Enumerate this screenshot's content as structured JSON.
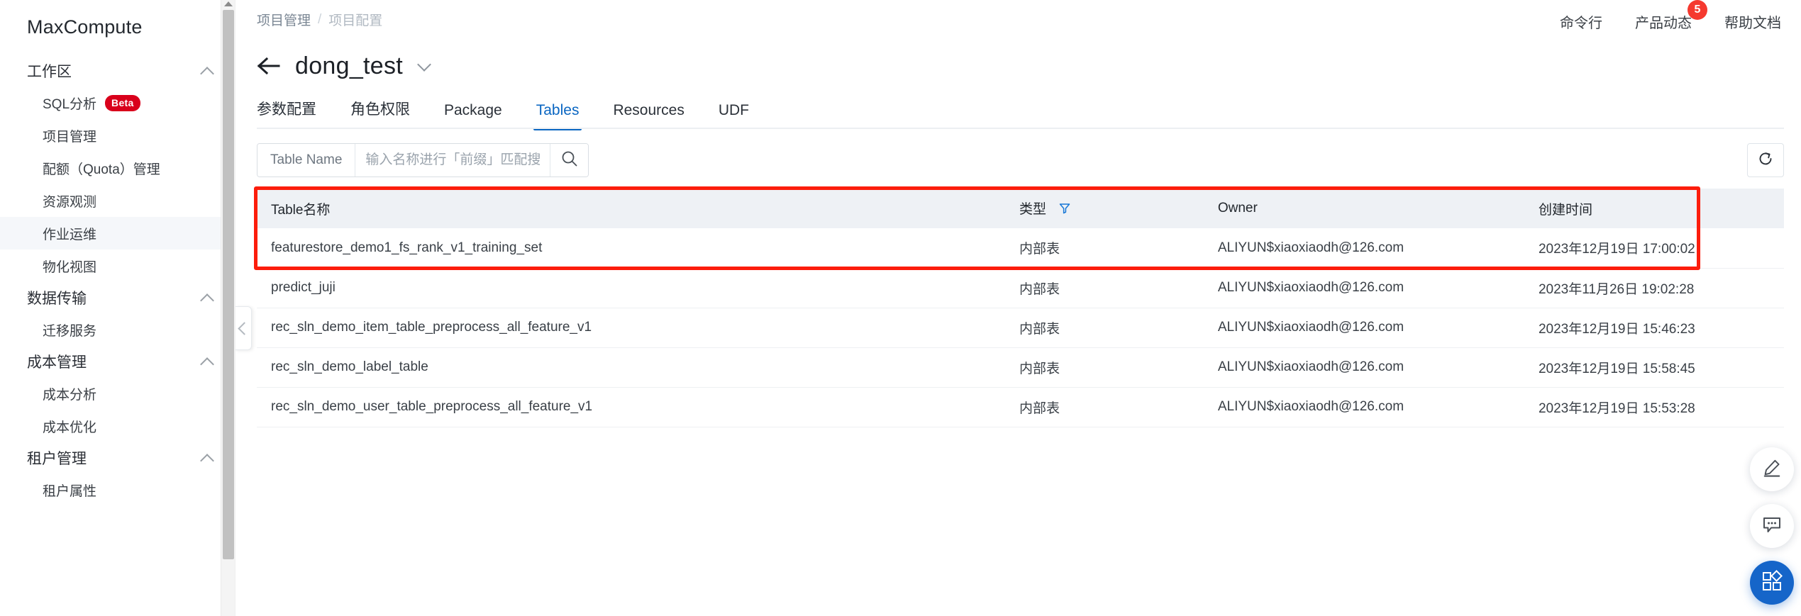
{
  "brand": "MaxCompute",
  "sidebar": {
    "groups": [
      {
        "label": "工作区",
        "items": [
          {
            "label": "SQL分析",
            "badge": "Beta",
            "active": false
          },
          {
            "label": "项目管理",
            "active": false
          },
          {
            "label": "配额（Quota）管理",
            "active": false
          },
          {
            "label": "资源观测",
            "active": false
          },
          {
            "label": "作业运维",
            "active": true
          },
          {
            "label": "物化视图",
            "active": false
          }
        ]
      },
      {
        "label": "数据传输",
        "items": [
          {
            "label": "迁移服务",
            "active": false
          }
        ]
      },
      {
        "label": "成本管理",
        "items": [
          {
            "label": "成本分析",
            "active": false
          },
          {
            "label": "成本优化",
            "active": false
          }
        ]
      },
      {
        "label": "租户管理",
        "items": [
          {
            "label": "租户属性",
            "active": false
          }
        ]
      }
    ]
  },
  "breadcrumb": {
    "parent": "项目管理",
    "separator": "/",
    "current": "项目配置"
  },
  "topnav": {
    "items": [
      {
        "label": "命令行",
        "badge": ""
      },
      {
        "label": "产品动态",
        "badge": "5"
      },
      {
        "label": "帮助文档",
        "badge": ""
      }
    ],
    "badge_color": "#f5392f"
  },
  "page": {
    "title": "dong_test"
  },
  "tabs": [
    {
      "label": "参数配置",
      "active": false
    },
    {
      "label": "角色权限",
      "active": false
    },
    {
      "label": "Package",
      "active": false
    },
    {
      "label": "Tables",
      "active": true
    },
    {
      "label": "Resources",
      "active": false
    },
    {
      "label": "UDF",
      "active": false
    }
  ],
  "accent_color": "#0a66c2",
  "highlight_color": "#fc1d0c",
  "search": {
    "prefix_label": "Table Name",
    "placeholder": "输入名称进行「前缀」匹配搜索",
    "value": ""
  },
  "table": {
    "columns": [
      "Table名称",
      "类型",
      "Owner",
      "创建时间"
    ],
    "rows": [
      {
        "name": "featurestore_demo1_fs_rank_v1_training_set",
        "type": "内部表",
        "owner": "ALIYUN$xiaoxiaodh@126.com",
        "created": "2023年12月19日 17:00:02"
      },
      {
        "name": "predict_juji",
        "type": "内部表",
        "owner": "ALIYUN$xiaoxiaodh@126.com",
        "created": "2023年11月26日 19:02:28"
      },
      {
        "name": "rec_sln_demo_item_table_preprocess_all_feature_v1",
        "type": "内部表",
        "owner": "ALIYUN$xiaoxiaodh@126.com",
        "created": "2023年12月19日 15:46:23"
      },
      {
        "name": "rec_sln_demo_label_table",
        "type": "内部表",
        "owner": "ALIYUN$xiaoxiaodh@126.com",
        "created": "2023年12月19日 15:58:45"
      },
      {
        "name": "rec_sln_demo_user_table_preprocess_all_feature_v1",
        "type": "内部表",
        "owner": "ALIYUN$xiaoxiaodh@126.com",
        "created": "2023年12月19日 15:53:28"
      }
    ]
  },
  "icons": {
    "search": "search-icon",
    "refresh": "refresh-icon",
    "filter": "filter-icon",
    "back": "back-arrow-icon",
    "edit_fab": "pencil-icon",
    "chat_fab": "chat-bubble-icon",
    "apps_fab": "apps-grid-icon",
    "collapse": "chevron-left-icon"
  }
}
